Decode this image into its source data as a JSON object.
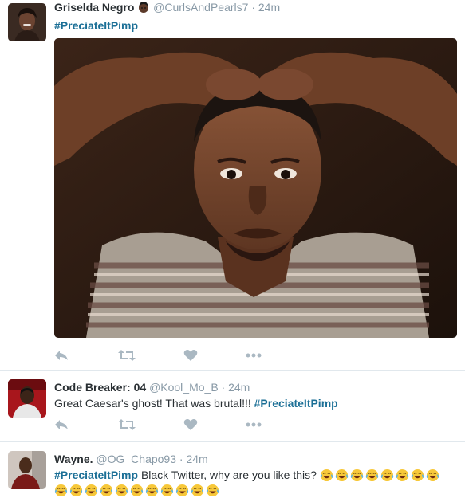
{
  "tweets": [
    {
      "name": "Griselda Negro",
      "handle": "@CurlsAndPearls7",
      "sep": "·",
      "time": "24m",
      "hashtag": "#PreciateItPimp",
      "text_before": "",
      "text_after": ""
    },
    {
      "name": "Code Breaker: 04",
      "handle": "@Kool_Mo_B",
      "sep": "·",
      "time": "24m",
      "text_before": "Great Caesar's ghost! That was brutal!!! ",
      "hashtag": "#PreciateItPimp",
      "text_after": ""
    },
    {
      "name": "Wayne.",
      "handle": "@OG_Chapo93",
      "sep": "·",
      "time": "24m",
      "text_before": "",
      "hashtag": "#PreciateItPimp",
      "text_after": " Black Twitter, why are you like this?"
    }
  ],
  "icons": {
    "reply": "reply-icon",
    "retweet": "retweet-icon",
    "like": "heart-icon",
    "more": "more-icon",
    "emoji": "face-with-tears-of-joy-emoji"
  },
  "colors": {
    "hashtag": "#1b6f96",
    "muted": "#8899a6",
    "action": "#aab8c2",
    "divider": "#e1e8ed",
    "text": "#292f33"
  }
}
